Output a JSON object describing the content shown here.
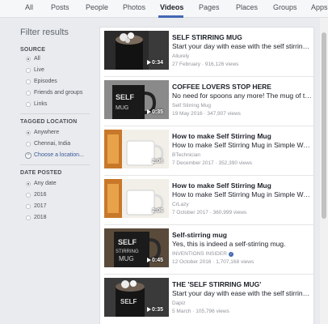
{
  "tabs": [
    {
      "label": "All"
    },
    {
      "label": "Posts"
    },
    {
      "label": "People"
    },
    {
      "label": "Photos"
    },
    {
      "label": "Videos",
      "active": true
    },
    {
      "label": "Pages"
    },
    {
      "label": "Places"
    },
    {
      "label": "Groups"
    },
    {
      "label": "Apps"
    }
  ],
  "sidebar": {
    "title": "Filter results",
    "source": {
      "heading": "SOURCE",
      "options": [
        "All",
        "Live",
        "Episodes",
        "Friends and groups",
        "Links"
      ],
      "selected": "All"
    },
    "location": {
      "heading": "TAGGED LOCATION",
      "options": [
        "Anywhere",
        "Chennai, India"
      ],
      "selected": "Anywhere",
      "choose_label": "Choose a location..."
    },
    "date": {
      "heading": "DATE POSTED",
      "options": [
        "Any date",
        "2016",
        "2017",
        "2018"
      ],
      "selected": "Any date"
    }
  },
  "videos": [
    {
      "title": "SELF STIRRING MUG",
      "desc": "Start your day with ease with the self stirring mug...",
      "channel": "Aliurely",
      "date": "27 February",
      "views": "916,126 views",
      "duration": "0:34",
      "verified": false
    },
    {
      "title": "COFFEE LOVERS STOP HERE",
      "desc": "No need for spoons any more! The mug of the...",
      "channel": "Self Stirring Mug",
      "date": "19 May 2016",
      "views": "347,907 views",
      "duration": "0:35",
      "verified": false
    },
    {
      "title": "How to make Self Stirring Mug",
      "desc": "How to make Self Stirring Mug in Simple Way Via...",
      "channel": "BTechnician",
      "date": "7 December 2017",
      "views": "352,390 views",
      "duration": "2:06",
      "verified": false
    },
    {
      "title": "How to make Self Stirring Mug",
      "desc": "How to make Self Stirring Mug in Simple Way Via...",
      "channel": "CrLazy",
      "date": "7 October 2017",
      "views": "360,999 views",
      "duration": "2:06",
      "verified": false
    },
    {
      "title": "Self-stirring mug",
      "desc": "Yes, this is indeed a self-stirring mug.",
      "channel": "INVENTIONS INSIDER",
      "date": "12 October 2016",
      "views": "1,707,168 views",
      "duration": "0:45",
      "verified": true
    },
    {
      "title": "THE 'SELF STIRRING MUG'",
      "desc": "Start your day with ease with the self stirring mug...",
      "channel": "Dapiz",
      "date": "5 March",
      "views": "105,796 views",
      "duration": "0:35",
      "verified": false
    }
  ],
  "colors": {
    "accent": "#4267b2",
    "page_bg": "#e9ebee",
    "card_bg": "#ffffff"
  }
}
